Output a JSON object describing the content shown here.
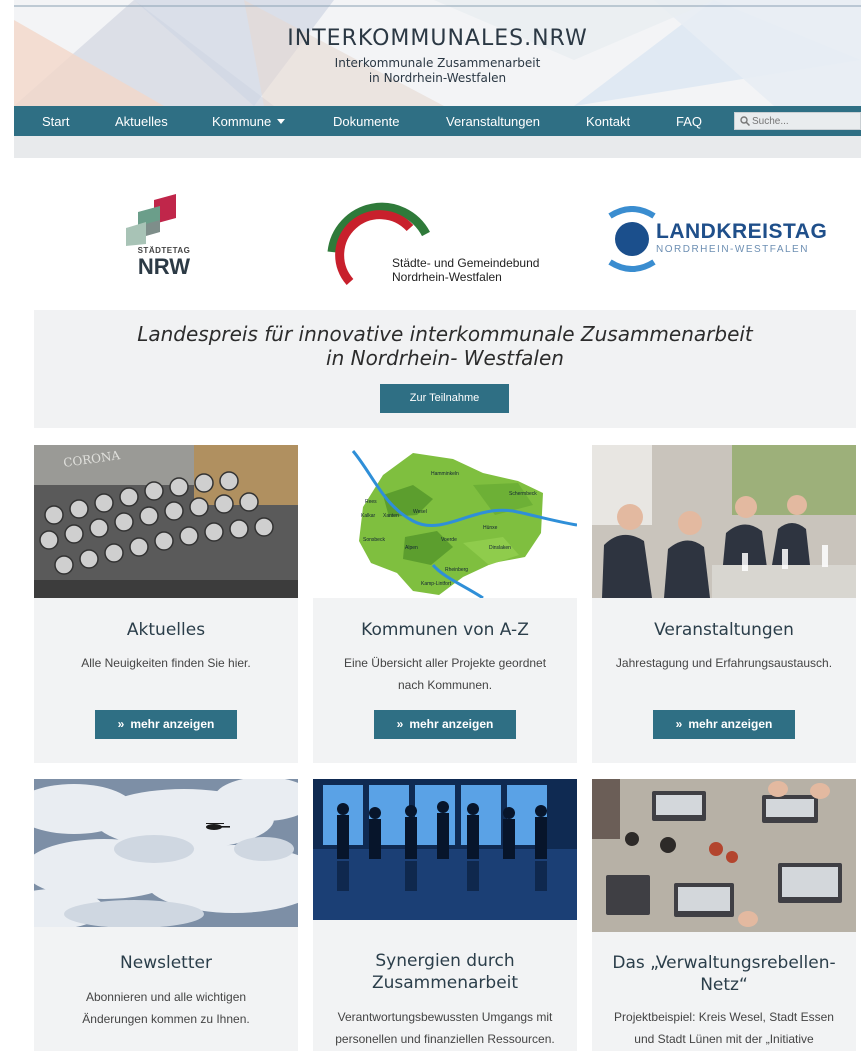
{
  "site": {
    "title": "INTERKOMMUNALES.NRW",
    "subtitle_line1": "Interkommunale Zusammenarbeit",
    "subtitle_line2": "in Nordrhein-Westfalen"
  },
  "nav": {
    "items": [
      "Start",
      "Aktuelles",
      "Kommune",
      "Dokumente",
      "Veranstaltungen",
      "Kontakt",
      "FAQ"
    ],
    "search_placeholder": "Suche..."
  },
  "logos": {
    "staedtetag_small": "STÄDTETAG",
    "staedtetag_big": "NRW",
    "gemeindebund_line1": "Städte- und Gemeindebund",
    "gemeindebund_line2": "Nordrhein-Westfalen",
    "landkreistag_title": "LANDKREISTAG",
    "landkreistag_sub": "NORDRHEIN-WESTFALEN"
  },
  "prize": {
    "line1": "Landespreis für innovative interkommunale Zusammenarbeit",
    "line2": "in Nordrhein- Westfalen",
    "button": "Zur Teilnahme"
  },
  "cards": [
    {
      "title": "Aktuelles",
      "text1": "Alle Neuigkeiten finden Sie hier.",
      "text2": "",
      "button": "mehr anzeigen",
      "image_label": "CORONA"
    },
    {
      "title": "Kommunen von A-Z",
      "text1": "Eine Übersicht aller Projekte geordnet",
      "text2": "nach Kommunen.",
      "button": "mehr anzeigen"
    },
    {
      "title": "Veranstaltungen",
      "text1": "Jahrestagung und Erfahrungsaustausch.",
      "text2": "",
      "button": "mehr anzeigen"
    },
    {
      "title": "Newsletter",
      "text1": "Abonnieren und alle wichtigen",
      "text2": "Änderungen kommen zu Ihnen."
    },
    {
      "title_line1": "Synergien durch",
      "title_line2": "Zusammenarbeit",
      "text1": "Verantwortungsbewussten Umgangs mit",
      "text2": "personellen und finanziellen Ressourcen."
    },
    {
      "title_line1": "Das „Verwaltungsrebellen-",
      "title_line2": "Netz“",
      "text1": "Projektbeispiel: Kreis Wesel, Stadt Essen",
      "text2": "und Stadt Lünen mit der „Initiative"
    }
  ],
  "map_labels": [
    "Hamminkeln",
    "Schermbeck",
    "Rees",
    "Kalkar",
    "Wesel",
    "Hünxe",
    "Sonsbeck",
    "Xanten",
    "Voerde",
    "Dinslaken",
    "Alpen",
    "Rheinberg",
    "Kamp-Lintfort"
  ],
  "colors": {
    "nav": "#2f6f84",
    "button": "#2f6f84",
    "card_bg": "#f2f3f4",
    "title": "#2b3e4a"
  }
}
